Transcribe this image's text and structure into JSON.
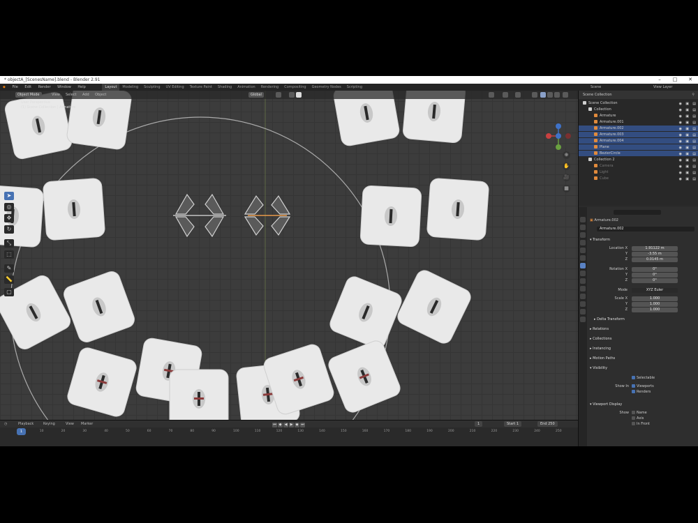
{
  "window": {
    "title": "* objectA_[ScenesName].blend - Blender 2.91",
    "controls": [
      "–",
      "□",
      "✕"
    ]
  },
  "menubar": {
    "menus": [
      "File",
      "Edit",
      "Render",
      "Window",
      "Help"
    ],
    "workspaces": [
      "Layout",
      "Modeling",
      "Sculpting",
      "UV Editing",
      "Texture Paint",
      "Shading",
      "Animation",
      "Rendering",
      "Compositing",
      "Geometry Nodes",
      "Scripting"
    ],
    "active_workspace": "Layout",
    "scene": "Scene",
    "view_layer": "View Layer"
  },
  "viewport": {
    "header": {
      "mode": "Object Mode",
      "menus": [
        "View",
        "Select",
        "Add",
        "Object"
      ],
      "transform": "Global"
    },
    "object_info": [
      "User Perspective",
      "(1) Scene Collection | Armature"
    ],
    "tools": [
      "select-icon",
      "cursor-icon",
      "move-icon",
      "rotate-icon",
      "scale-icon",
      "transform-icon",
      "annotate-icon",
      "measure-icon",
      "add-cube-icon"
    ],
    "active_tool": 0,
    "nav_buttons": [
      "⊕",
      "✋",
      "🎥",
      "▦"
    ]
  },
  "outliner": {
    "header": "Scene Collection",
    "rows": [
      {
        "label": "Scene Collection",
        "indent": 0,
        "sel": false,
        "dim": false
      },
      {
        "label": "Collection",
        "indent": 1,
        "sel": false,
        "dim": false
      },
      {
        "label": "Armature",
        "indent": 2,
        "sel": false,
        "dim": false
      },
      {
        "label": "Armature.001",
        "indent": 2,
        "sel": false,
        "dim": false
      },
      {
        "label": "Armature.002",
        "indent": 2,
        "sel": true,
        "dim": false
      },
      {
        "label": "Armature.003",
        "indent": 2,
        "sel": true,
        "dim": false
      },
      {
        "label": "Armature.004",
        "indent": 2,
        "sel": true,
        "dim": false
      },
      {
        "label": "Plane",
        "indent": 2,
        "sel": true,
        "dim": false
      },
      {
        "label": "BezierCircle",
        "indent": 2,
        "sel": true,
        "dim": false
      },
      {
        "label": "Collection 2",
        "indent": 1,
        "sel": false,
        "dim": false
      },
      {
        "label": "Camera",
        "indent": 2,
        "sel": false,
        "dim": true
      },
      {
        "label": "Light",
        "indent": 2,
        "sel": false,
        "dim": true
      },
      {
        "label": "Cube",
        "indent": 2,
        "sel": false,
        "dim": true
      }
    ]
  },
  "properties": {
    "search_placeholder": "",
    "object_name": "Armature.002",
    "data_name": "Armature.002",
    "sections": {
      "transform": "Transform",
      "delta": "Delta Transform",
      "relations": "Relations",
      "collections": "Collections",
      "instancing": "Instancing",
      "motion_paths": "Motion Paths",
      "visibility": "Visibility",
      "viewport_display": "Viewport Display"
    },
    "location": {
      "label_x": "Location X",
      "label_y": "Y",
      "label_z": "Z",
      "x": "1.91122 m",
      "y": "-3.55 m",
      "z": "0.0145 m"
    },
    "rotation": {
      "label_x": "Rotation X",
      "label_y": "Y",
      "label_z": "Z",
      "x": "0°",
      "y": "0°",
      "z": "0°"
    },
    "mode": {
      "label": "Mode",
      "value": "XYZ Euler"
    },
    "scale": {
      "label_x": "Scale X",
      "label_y": "Y",
      "label_z": "Z",
      "x": "1.000",
      "y": "1.000",
      "z": "1.000"
    },
    "visibility": {
      "selectable": "Selectable",
      "show_in_label": "Show In",
      "viewports": "Viewports",
      "renders": "Renders"
    },
    "display": {
      "show_label": "Show",
      "name": "Name",
      "axis": "Axis",
      "in_front": "In Front"
    }
  },
  "timeline": {
    "menus": [
      "Playback",
      "Keying",
      "View",
      "Marker"
    ],
    "current_frame": "1",
    "start_label": "Start",
    "start": "1",
    "end_label": "End",
    "end": "250",
    "ticks": [
      "10",
      "20",
      "30",
      "40",
      "50",
      "60",
      "70",
      "80",
      "90",
      "100",
      "110",
      "120",
      "130",
      "140",
      "150",
      "160",
      "170",
      "180",
      "190",
      "200",
      "210",
      "220",
      "230",
      "240",
      "250"
    ]
  }
}
